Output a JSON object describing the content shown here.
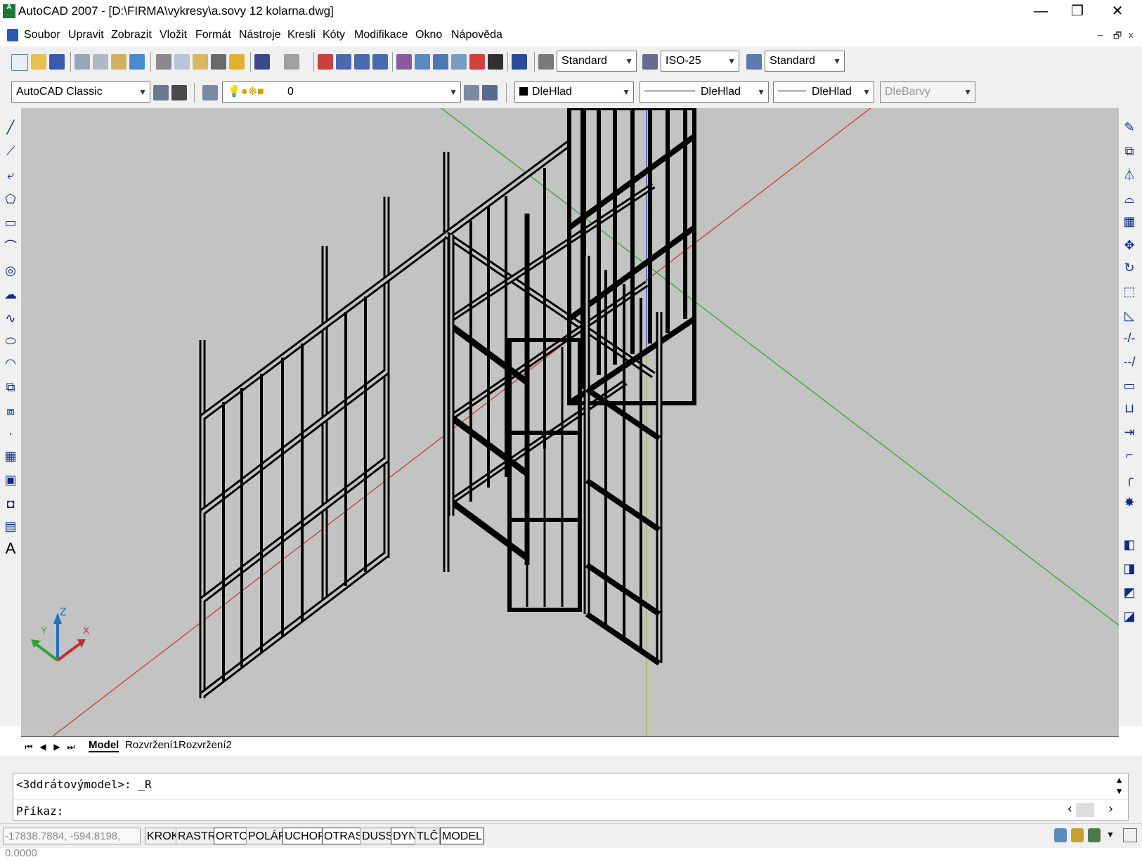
{
  "window": {
    "title": "AutoCAD 2007 - [D:\\FIRMA\\vykresy\\a.sovy 12 kolarna.dwg]",
    "app_icon_text": "A",
    "minimize": "—",
    "restore": "❐",
    "close": "✕"
  },
  "menubar": {
    "items": [
      "Soubor",
      "Upravit",
      "Zobrazit",
      "Vložit",
      "Formát",
      "Nástroje",
      "Kresli",
      "Kóty",
      "Modifikace",
      "Okno",
      "Nápověda"
    ],
    "doc_min": "–",
    "doc_restore": "🗗",
    "doc_close": "x"
  },
  "toolbar1": {
    "text_style": "Standard",
    "dim_style": "ISO-25",
    "table_style": "Standard"
  },
  "toolbar2": {
    "workspace": "AutoCAD Classic",
    "layer": "0",
    "color": "DleHlad",
    "linetype": "DleHlad",
    "lineweight": "DleHlad",
    "plotstyle": "DleBarvy"
  },
  "layout_tabs": {
    "tabs": [
      "Model",
      "Rozvržení1",
      "Rozvržení2"
    ],
    "active": "Model"
  },
  "ucs": {
    "x": "X",
    "y": "Y",
    "z": "Z"
  },
  "command": {
    "line1": "<3ddrátovýmodel>: _R",
    "line2": "Příkaz:"
  },
  "statusbar": {
    "coordinates": "-17838.7884, -594.8198, 0.0000",
    "buttons": [
      "KROK",
      "RASTR",
      "ORTO",
      "POLÁR",
      "UCHOP",
      "OTRAS",
      "DUSS",
      "DYN",
      "TLČ",
      "MODEL"
    ],
    "active_buttons": [
      "ORTO",
      "UCHOP",
      "OTRAS",
      "DYN",
      "MODEL"
    ]
  },
  "colors": {
    "viewport_bg": "#c3c3c3",
    "axis_x": "#c83030",
    "axis_y": "#2aa02a",
    "axis_z": "#2040c0",
    "wire": "#000000"
  }
}
